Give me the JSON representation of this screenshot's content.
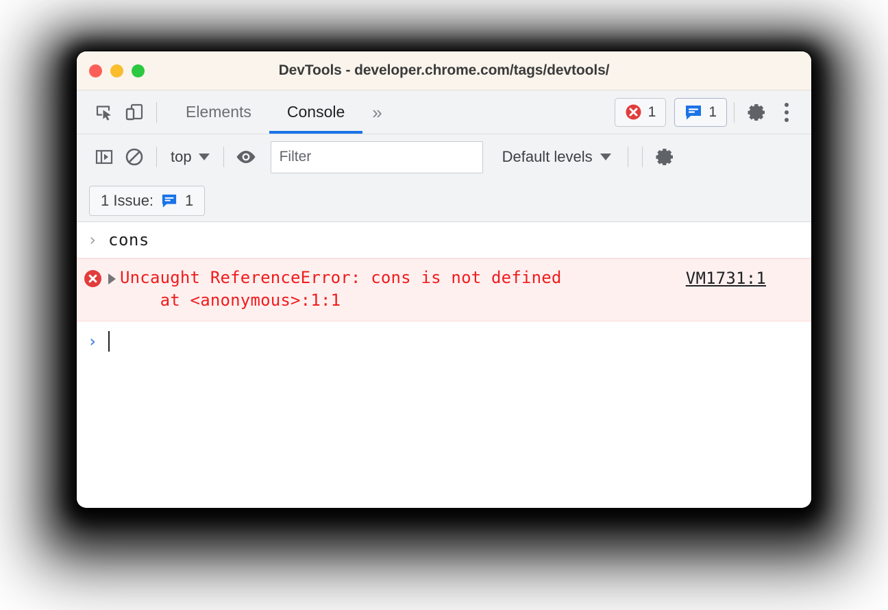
{
  "window": {
    "title": "DevTools - developer.chrome.com/tags/devtools/",
    "traffic_lights": {
      "close": "close-window",
      "minimize": "minimize-window",
      "maximize": "maximize-window"
    },
    "colors": {
      "titlebar_bg": "#faf4ec",
      "toolbar_bg": "#f1f3f4",
      "accent_blue": "#1a73e8",
      "error_red": "#f01c1c",
      "error_row_bg": "#fff0f0",
      "issue_blue": "#1a73e8"
    }
  },
  "main_toolbar": {
    "inspect_icon": "inspect-element-icon",
    "device_icon": "device-toolbar-icon",
    "tabs": [
      {
        "label": "Elements",
        "active": false
      },
      {
        "label": "Console",
        "active": true
      }
    ],
    "more_tabs_label": "»",
    "error_badge": {
      "icon": "error-circle-icon",
      "count": "1"
    },
    "issue_badge": {
      "icon": "issue-message-icon",
      "count": "1"
    },
    "settings_icon": "gear-icon",
    "kebab_icon": "more-options-icon"
  },
  "console_toolbar": {
    "sidebar_toggle_icon": "console-sidebar-icon",
    "clear_console_icon": "clear-console-icon",
    "context_label": "top",
    "eye_icon": "live-expression-eye-icon",
    "filter": {
      "placeholder": "Filter",
      "value": ""
    },
    "levels_label": "Default levels",
    "settings_icon": "console-settings-gear-icon"
  },
  "issues_bar": {
    "label": "1 Issue:",
    "icon": "issue-message-icon",
    "count": "1"
  },
  "console": {
    "input_echo": {
      "prompt": "›",
      "text": "cons"
    },
    "error": {
      "icon": "error-circle-icon",
      "disclosure": "expand-triangle-icon",
      "line1": "Uncaught ReferenceError: cons is not defined",
      "line2": "    at <anonymous>:1:1",
      "source_link": "VM1731:1"
    },
    "prompt": {
      "chevron": "›",
      "value": ""
    }
  }
}
